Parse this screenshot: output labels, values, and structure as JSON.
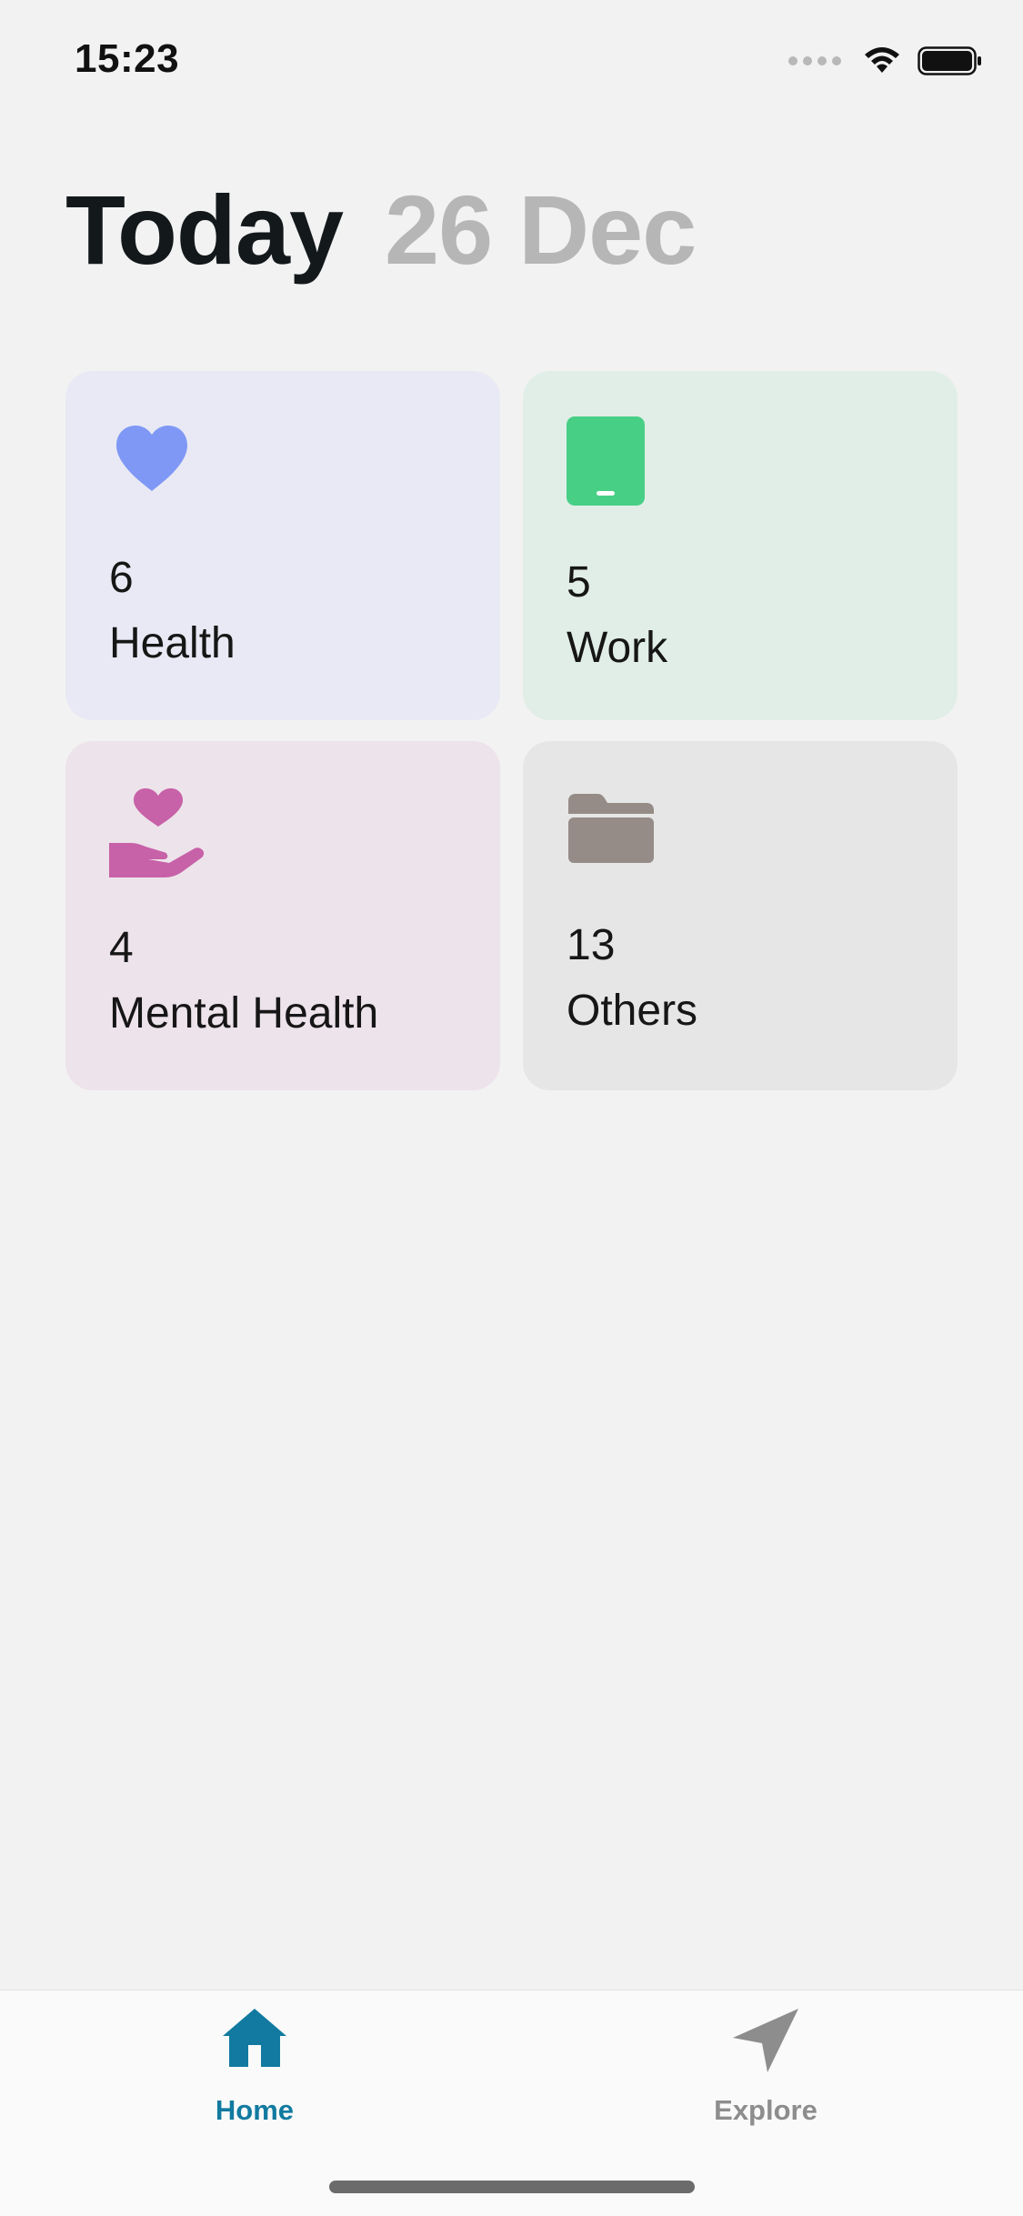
{
  "status_bar": {
    "time": "15:23"
  },
  "header": {
    "title": "Today",
    "date": "26 Dec"
  },
  "categories": [
    {
      "count": "6",
      "label": "Health",
      "icon": "heart-icon",
      "bg": "#e8e9f4",
      "icon_color": "#7f98f5"
    },
    {
      "count": "5",
      "label": "Work",
      "icon": "tablet-icon",
      "bg": "#e1eee7",
      "icon_color": "#48cf86"
    },
    {
      "count": "4",
      "label": "Mental Health",
      "icon": "hand-heart-icon",
      "bg": "#ede3ea",
      "icon_color": "#c761a8"
    },
    {
      "count": "13",
      "label": "Others",
      "icon": "folder-icon",
      "bg": "#e6e6e6",
      "icon_color": "#968c87"
    }
  ],
  "tab_bar": {
    "tabs": [
      {
        "label": "Home",
        "icon": "house-icon",
        "active": true,
        "color": "#127aa0"
      },
      {
        "label": "Explore",
        "icon": "paper-plane-icon",
        "active": false,
        "color": "#8d8d8d"
      }
    ]
  }
}
